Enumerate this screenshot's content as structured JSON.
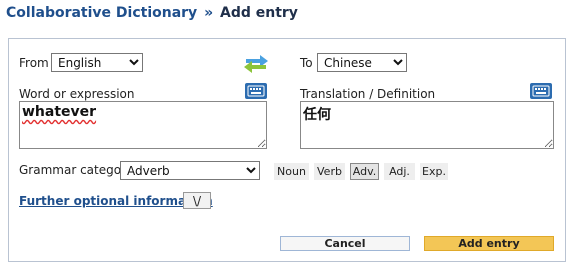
{
  "header": {
    "breadcrumb_root": "Collaborative Dictionary",
    "separator": "»",
    "current": "Add entry"
  },
  "form": {
    "from_label": "From",
    "from_value": "English",
    "to_label": "To",
    "to_value": "Chinese",
    "word_label": "Word or expression",
    "word_value": "whatever",
    "translation_label": "Translation / Definition",
    "translation_value": "任何",
    "grammar_label": "Grammar category",
    "grammar_value": "Adverb",
    "grammar_buttons": [
      "Noun",
      "Verb",
      "Adv.",
      "Adj.",
      "Exp."
    ],
    "optional_link": "Further optional information",
    "optional_toggle": "\\/",
    "cancel_label": "Cancel",
    "add_label": "Add entry"
  },
  "colors": {
    "title_blue": "#1f4f8c",
    "add_button": "#f3c656",
    "keyboard_icon": "#2c6cb0"
  }
}
